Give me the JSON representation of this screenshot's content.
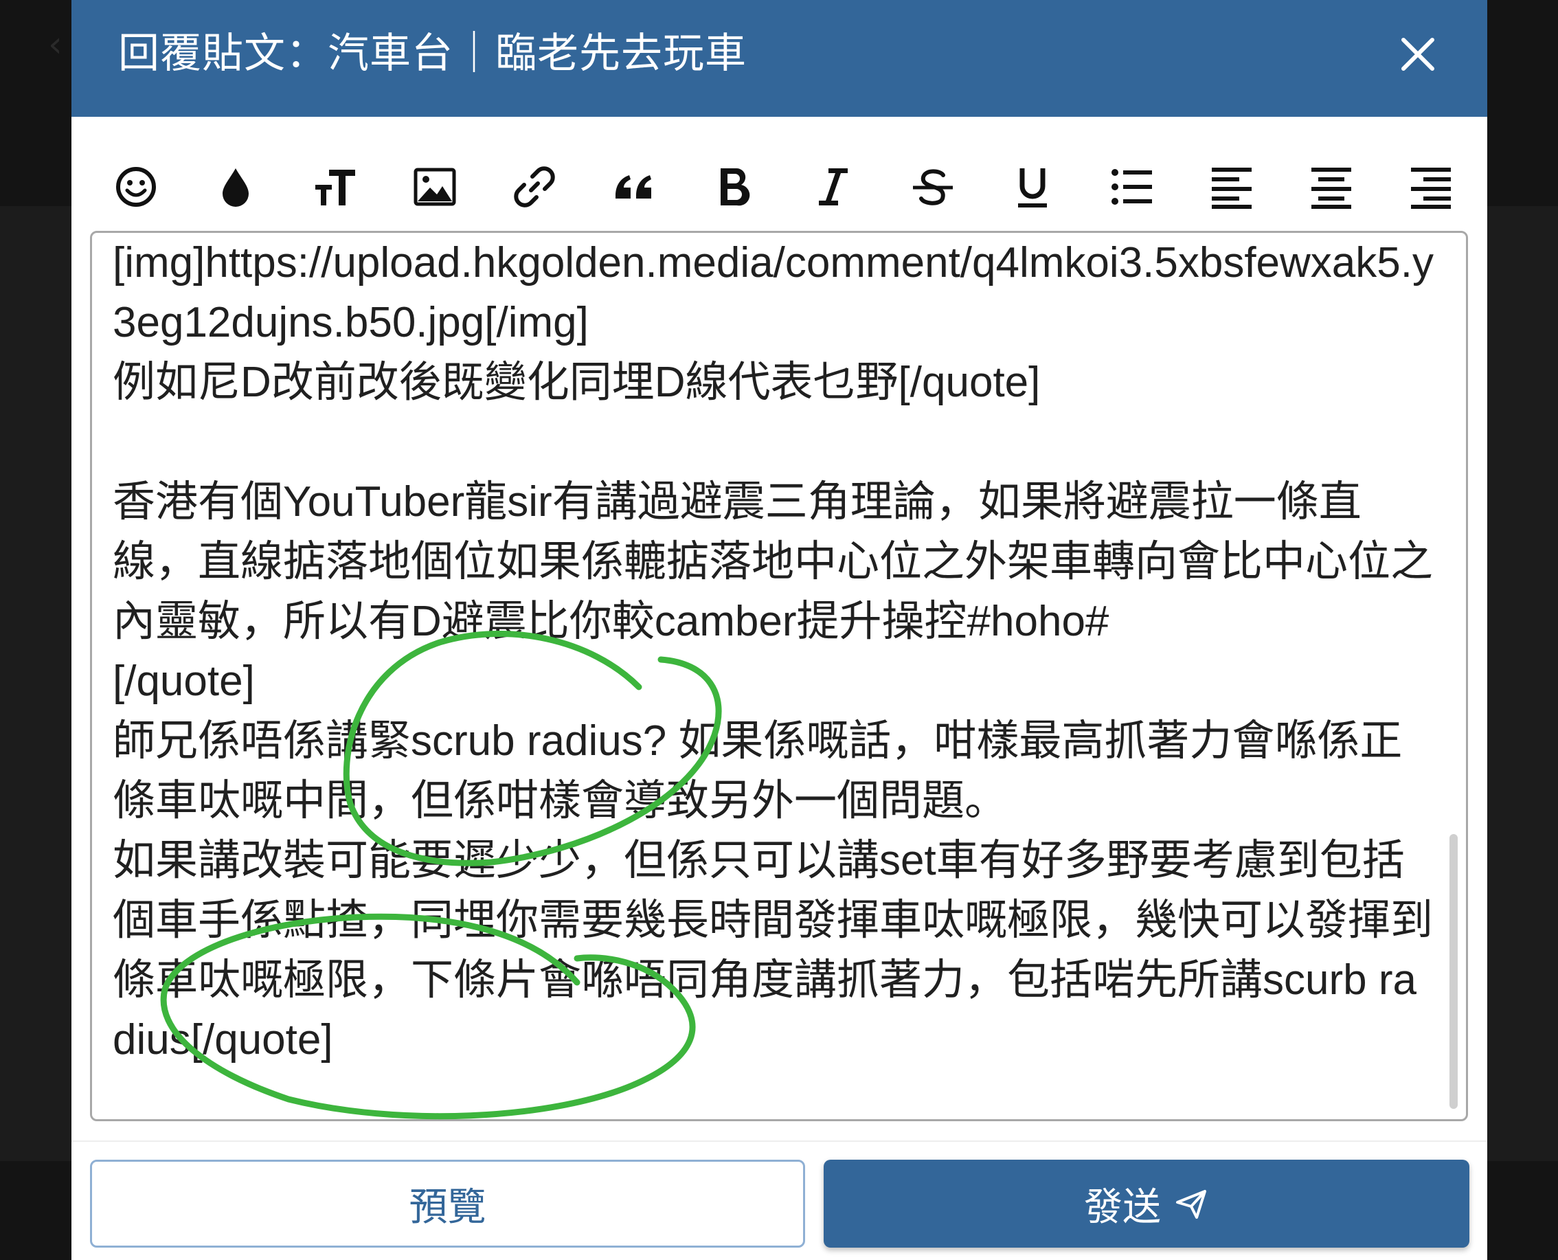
{
  "header": {
    "title": "回覆貼文：汽車台｜臨老先去玩車"
  },
  "toolbar": {
    "icons": [
      "emoji-icon",
      "color-drop-icon",
      "text-size-icon",
      "image-icon",
      "link-icon",
      "quote-icon",
      "bold-icon",
      "italic-icon",
      "strikethrough-icon",
      "underline-icon",
      "bullet-list-icon",
      "align-left-icon",
      "align-center-icon",
      "align-right-icon"
    ]
  },
  "editor": {
    "value": "[img]https://upload.hkgolden.media/comment/q4lmkoi3.5xbsfewxak5.y3eg12dujns.b50.jpg[/img]\n例如尼D改前改後既變化同埋D線代表乜野[/quote]\n\n香港有個YouTuber龍sir有講過避震三角理論，如果將避震拉一條直線，直線掂落地個位如果係轆掂落地中心位之外架車轉向會比中心位之內靈敏，所以有D避震比你較camber提升操控#hoho#\n[/quote]\n師兄係唔係講緊scrub radius? 如果係嘅話，咁樣最高抓著力會喺係正條車呔嘅中間，但係咁樣會導致另外一個問題。\n如果講改裝可能要遲少少，但係只可以講set車有好多野要考慮到包括個車手係點揸，同埋你需要幾長時間發揮車呔嘅極限，幾快可以發揮到條車呔嘅極限，下條片會喺唔同角度講抓著力，包括啱先所講scurb radius[/quote]"
  },
  "footer": {
    "preview_label": "預覽",
    "send_label": "發送"
  },
  "colors": {
    "header_bg": "#336699",
    "annotation_stroke": "#3db53d"
  }
}
